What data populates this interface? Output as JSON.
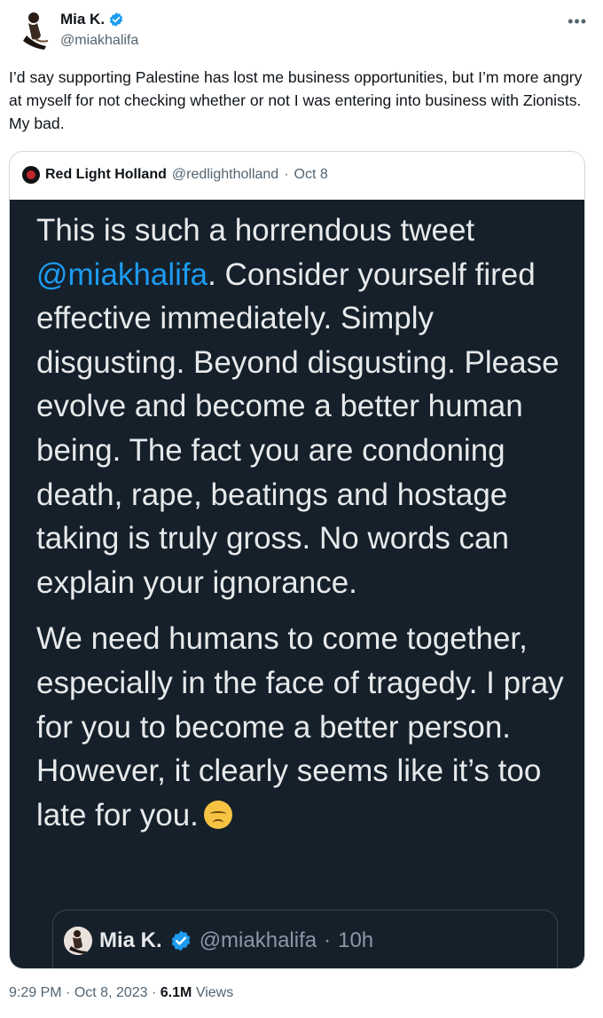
{
  "header": {
    "display_name": "Mia K.",
    "handle": "@miakhalifa",
    "verified_icon": "verified-badge-icon",
    "more_icon": "more-options-icon"
  },
  "tweet": {
    "text": "I’d say supporting Palestine has lost me business opportunities, but I’m more angry at myself for not checking whether or not I was entering into business with Zionists. My bad."
  },
  "quoted": {
    "author": "Red Light Holland",
    "handle": "@redlightholland",
    "separator": "·",
    "date": "Oct 8",
    "screenshot": {
      "p1_before": "This is such a horrendous tweet ",
      "p1_mention": "@miakhalifa",
      "p1_after": ". Consider yourself fired effective immediately. Simply disgusting. Beyond disgusting. Please evolve and become a better human being. The fact you are condoning death, rape, beatings and hostage taking is truly gross. No words can explain your ignorance.",
      "p2": "We need humans to come together, especially in the face of tragedy. I pray for you to become a better person. However, it clearly seems like it’s too late for you.",
      "emoji": "disappointed-face-emoji",
      "inner_quote": {
        "author": "Mia K.",
        "handle": "@miakhalifa",
        "separator": "·",
        "age": "10h"
      }
    }
  },
  "footer": {
    "time": "9:29 PM",
    "separator": "·",
    "date": "Oct 8, 2023",
    "separator2": "·",
    "views_count": "6.1M",
    "views_label": "Views"
  },
  "colors": {
    "accent": "#1d9bf0",
    "dark_bg": "#15202b",
    "secondary_text": "#536471"
  }
}
